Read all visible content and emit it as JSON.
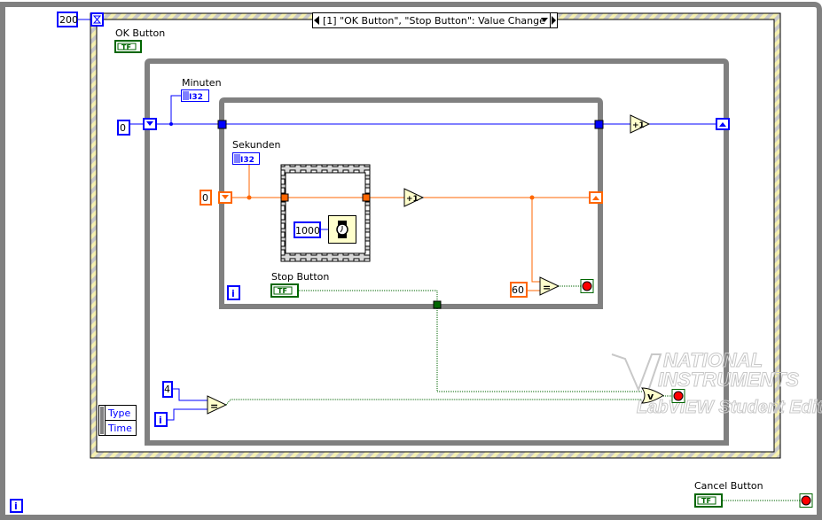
{
  "diagram": {
    "timeout_constant": "200",
    "event_selector": "[1] \"OK Button\", \"Stop Button\": Value Change",
    "ok_button_label": "OK Button",
    "minuten_label": "Minuten",
    "minuten_type": "I32",
    "minuten_init": "0",
    "sekunden_label": "Sekunden",
    "sekunden_type": "I32",
    "sekunden_init": "0",
    "wait_ms": "1000",
    "increment_label": "+1",
    "compare_sixty": "60",
    "equals_label": "=",
    "or_label": "v",
    "stop_button_label": "Stop Button",
    "iteration_label": "i",
    "four_constant": "4",
    "event_data_items": [
      "Type",
      "Time"
    ],
    "cancel_button_label": "Cancel Button",
    "bool_terminal_text": "TF",
    "watermark": [
      "NATIONAL",
      "INSTRUMENTS",
      "LabVIEW Student Edition"
    ]
  },
  "colors": {
    "loop_border": "#808080",
    "integer_wire": "#0000ff",
    "i32_wire": "#ff6600",
    "boolean_wire": "#006600",
    "event_structure_hatch": "#f5f0b0",
    "function_fill": "#ffffcc",
    "stop_red": "#ff0000"
  }
}
